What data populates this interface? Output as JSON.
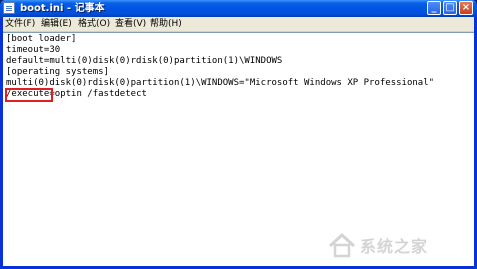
{
  "window": {
    "title": "boot.ini - 记事本"
  },
  "title_buttons": {
    "minimize": "_",
    "maximize": "□",
    "close": "×"
  },
  "menu": {
    "items": [
      "文件(F)",
      "编辑(E)",
      "格式(O)",
      "查看(V)",
      "帮助(H)"
    ]
  },
  "editor": {
    "lines": [
      "[boot loader]",
      "timeout=30",
      "default=multi(0)disk(0)rdisk(0)partition(1)\\WINDOWS",
      "[operating systems]",
      "multi(0)disk(0)rdisk(0)partition(1)\\WINDOWS=\"Microsoft Windows XP Professional\"",
      "/fastdetect"
    ],
    "highlighted": "/execute",
    "last_line_middle": "=optin "
  },
  "watermark": {
    "text": "系统之家",
    "color": "#a0a0a0"
  },
  "colors": {
    "titlebar": "#0054e3",
    "menubar": "#ece9d8",
    "highlight_border": "#e02020"
  }
}
